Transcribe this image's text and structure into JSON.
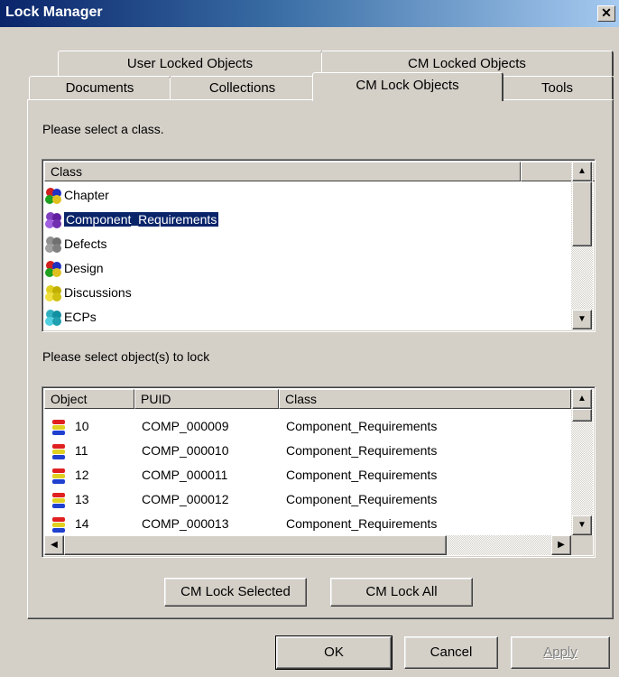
{
  "window": {
    "title": "Lock Manager",
    "close_label": "✕"
  },
  "tabs_back": [
    {
      "label": "User Locked Objects"
    },
    {
      "label": "CM Locked Objects"
    }
  ],
  "tabs_front": [
    {
      "label": "Documents"
    },
    {
      "label": "Collections"
    },
    {
      "label": "CM Lock Objects"
    },
    {
      "label": "Tools"
    }
  ],
  "class_section": {
    "prompt": "Please select a class.",
    "column_header": "Class",
    "items": [
      {
        "label": "Chapter",
        "icon": "cubes-multicolor-icon"
      },
      {
        "label": "Component_Requirements",
        "icon": "cubes-purple-icon",
        "selected": true
      },
      {
        "label": "Defects",
        "icon": "cubes-gray-icon"
      },
      {
        "label": "Design",
        "icon": "cubes-multicolor-icon"
      },
      {
        "label": "Discussions",
        "icon": "cubes-yellow-icon"
      },
      {
        "label": "ECPs",
        "icon": "cubes-cyan-icon"
      }
    ]
  },
  "object_section": {
    "prompt": "Please select object(s) to lock",
    "columns": [
      "Object",
      "PUID",
      "Class"
    ],
    "rows": [
      {
        "object": "10",
        "puid": "COMP_000009",
        "class": "Component_Requirements"
      },
      {
        "object": "11",
        "puid": "COMP_000010",
        "class": "Component_Requirements"
      },
      {
        "object": "12",
        "puid": "COMP_000011",
        "class": "Component_Requirements"
      },
      {
        "object": "13",
        "puid": "COMP_000012",
        "class": "Component_Requirements"
      },
      {
        "object": "14",
        "puid": "COMP_000013",
        "class": "Component_Requirements"
      }
    ]
  },
  "actions": {
    "cm_lock_selected": "CM Lock Selected",
    "cm_lock_all": "CM Lock All"
  },
  "footer": {
    "ok": "OK",
    "cancel": "Cancel",
    "apply": "Apply"
  }
}
